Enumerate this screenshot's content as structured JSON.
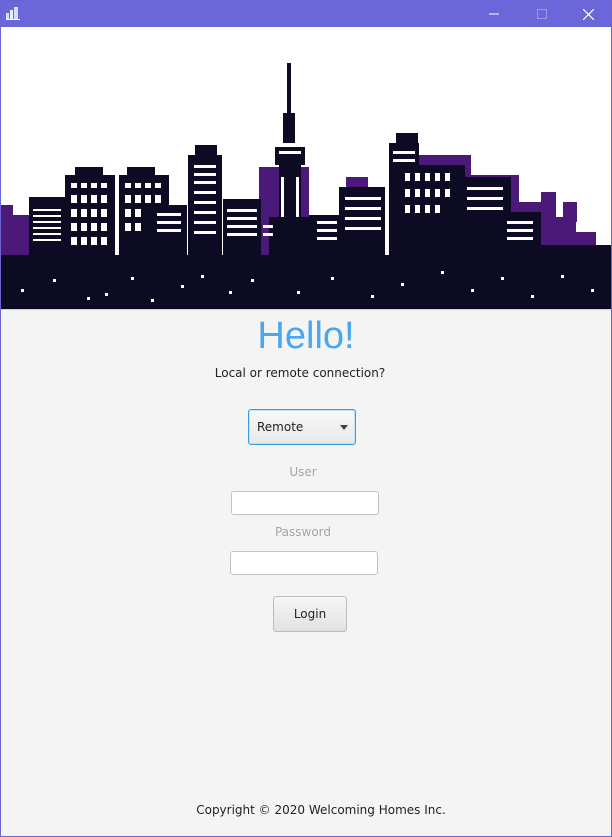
{
  "window": {
    "title_bar_color": "#6b66da"
  },
  "main": {
    "greeting": "Hello!",
    "prompt": "Local or remote connection?",
    "connection_select": {
      "selected": "Remote"
    },
    "user_label": "User",
    "user_value": "",
    "password_label": "Password",
    "password_value": "",
    "login_label": "Login"
  },
  "footer": {
    "copyright": "Copyright © 2020 Welcoming Homes Inc."
  },
  "colors": {
    "accent": "#4aa6ee",
    "skyline_dark": "#0d0b24",
    "skyline_purple": "#4b1a78",
    "focus_border": "#39a0db"
  },
  "icons": {
    "app": "city-buildings-icon",
    "minimize": "minimize-icon",
    "maximize": "maximize-icon",
    "close": "close-icon",
    "dropdown": "chevron-down-icon"
  }
}
